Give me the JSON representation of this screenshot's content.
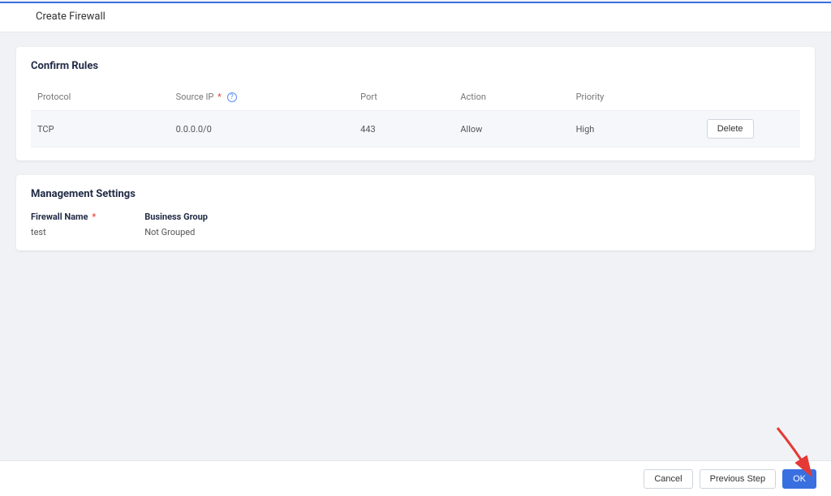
{
  "header": {
    "title": "Create Firewall"
  },
  "confirm_rules": {
    "title": "Confirm Rules",
    "columns": {
      "protocol": "Protocol",
      "source_ip": "Source IP",
      "port": "Port",
      "action": "Action",
      "priority": "Priority"
    },
    "rows": [
      {
        "protocol": "TCP",
        "source_ip": "0.0.0.0/0",
        "port": "443",
        "action": "Allow",
        "priority": "High",
        "delete_label": "Delete"
      }
    ]
  },
  "management_settings": {
    "title": "Management Settings",
    "firewall_name_label": "Firewall Name",
    "firewall_name_value": "test",
    "business_group_label": "Business Group",
    "business_group_value": "Not Grouped"
  },
  "footer": {
    "cancel": "Cancel",
    "previous": "Previous Step",
    "ok": "OK"
  },
  "symbols": {
    "required": "*",
    "help": "?"
  }
}
